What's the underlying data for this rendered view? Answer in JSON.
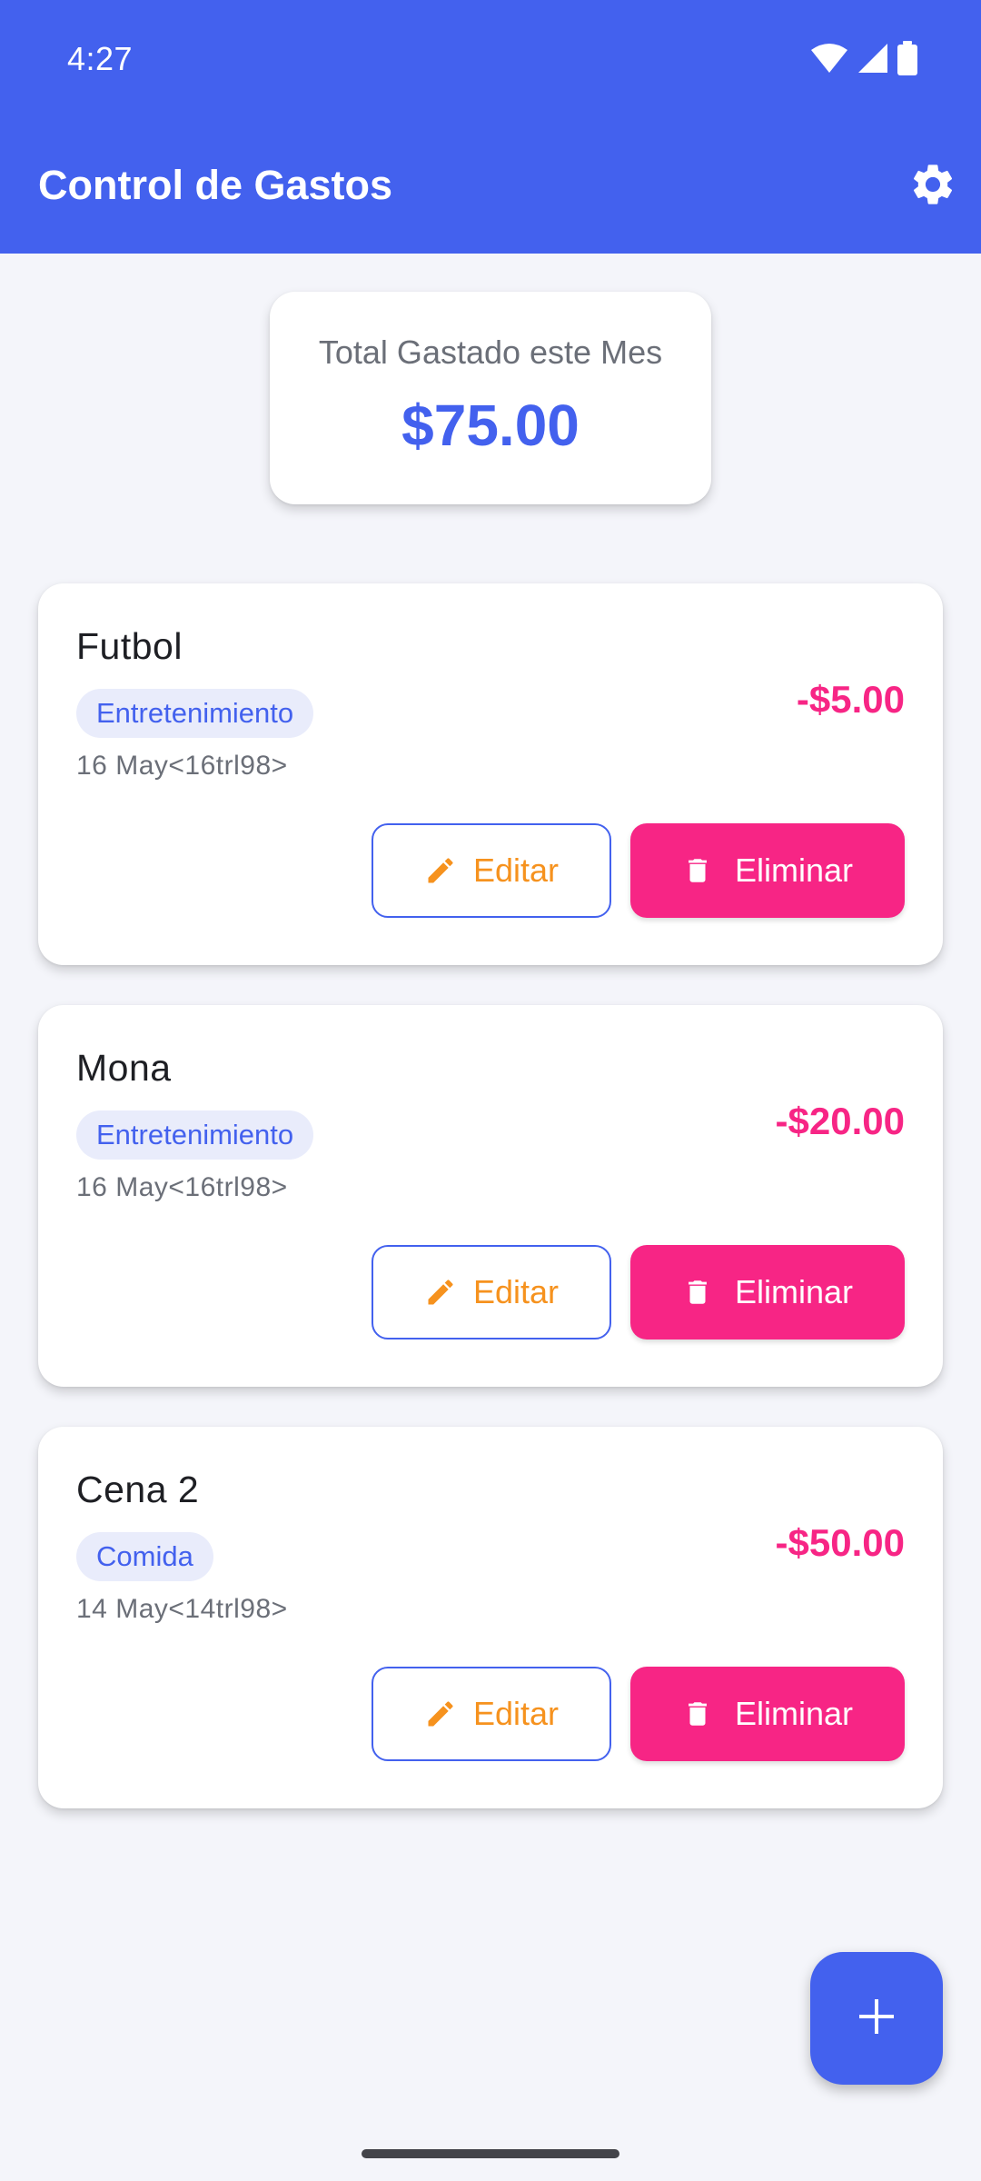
{
  "status_bar": {
    "time": "4:27",
    "icons": [
      "wifi-icon",
      "signal-icon",
      "battery-icon"
    ]
  },
  "app_bar": {
    "title": "Control de Gastos",
    "settings_icon": "gear-icon"
  },
  "summary": {
    "label": "Total Gastado este Mes",
    "total": "$75.00"
  },
  "expenses": [
    {
      "name": "Futbol",
      "category": "Entretenimiento",
      "date": "16 May<16trl98>",
      "amount": "-$5.00"
    },
    {
      "name": "Mona",
      "category": "Entretenimiento",
      "date": "16 May<16trl98>",
      "amount": "-$20.00"
    },
    {
      "name": "Cena 2",
      "category": "Comida",
      "date": "14 May<14trl98>",
      "amount": "-$50.00"
    }
  ],
  "actions": {
    "edit_label": "Editar",
    "delete_label": "Eliminar",
    "edit_icon": "pencil-icon",
    "delete_icon": "trash-icon"
  },
  "fab": {
    "icon": "plus-icon"
  },
  "colors": {
    "primary": "#4361ee",
    "accent_pink": "#f72585",
    "edit_orange": "#f6921e",
    "background": "#f4f5fa",
    "chip_bg": "#e9ecfb"
  }
}
